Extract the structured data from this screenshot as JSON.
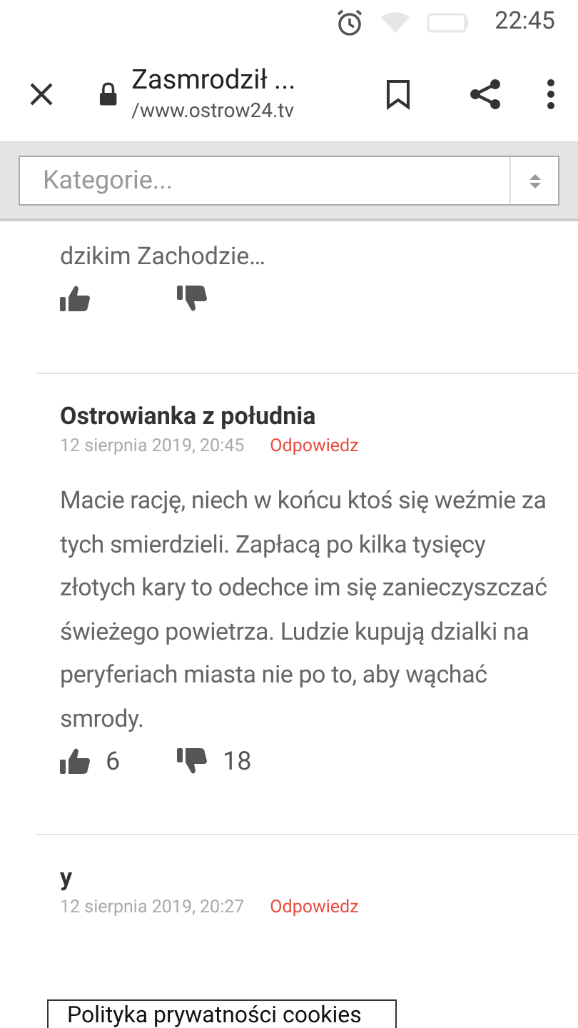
{
  "status_bar": {
    "time": "22:45"
  },
  "toolbar": {
    "title": "Zasmrodził ...",
    "url": "/www.ostrow24.tv"
  },
  "category_select": {
    "placeholder": "Kategorie..."
  },
  "comments": [
    {
      "text": "dzikim Zachodzie…"
    },
    {
      "author": "Ostrowianka z południa",
      "date": "12 sierpnia 2019, 20:45",
      "reply": "Odpowiedz",
      "text": "Macie rację, niech w końcu ktoś się weźmie za tych smierdzieli. Zapłacą po kilka tysięcy złotych kary to odechce im się zanieczyszczać świeżego powietrza. Ludzie kupują dzialki na peryferiach miasta nie po to, aby wąchać smrody.",
      "likes": "6",
      "dislikes": "18"
    },
    {
      "author": "y",
      "date": "12 sierpnia 2019, 20:27",
      "reply": "Odpowiedz"
    }
  ],
  "cookie_banner": {
    "label": "Polityka prywatności cookies"
  }
}
